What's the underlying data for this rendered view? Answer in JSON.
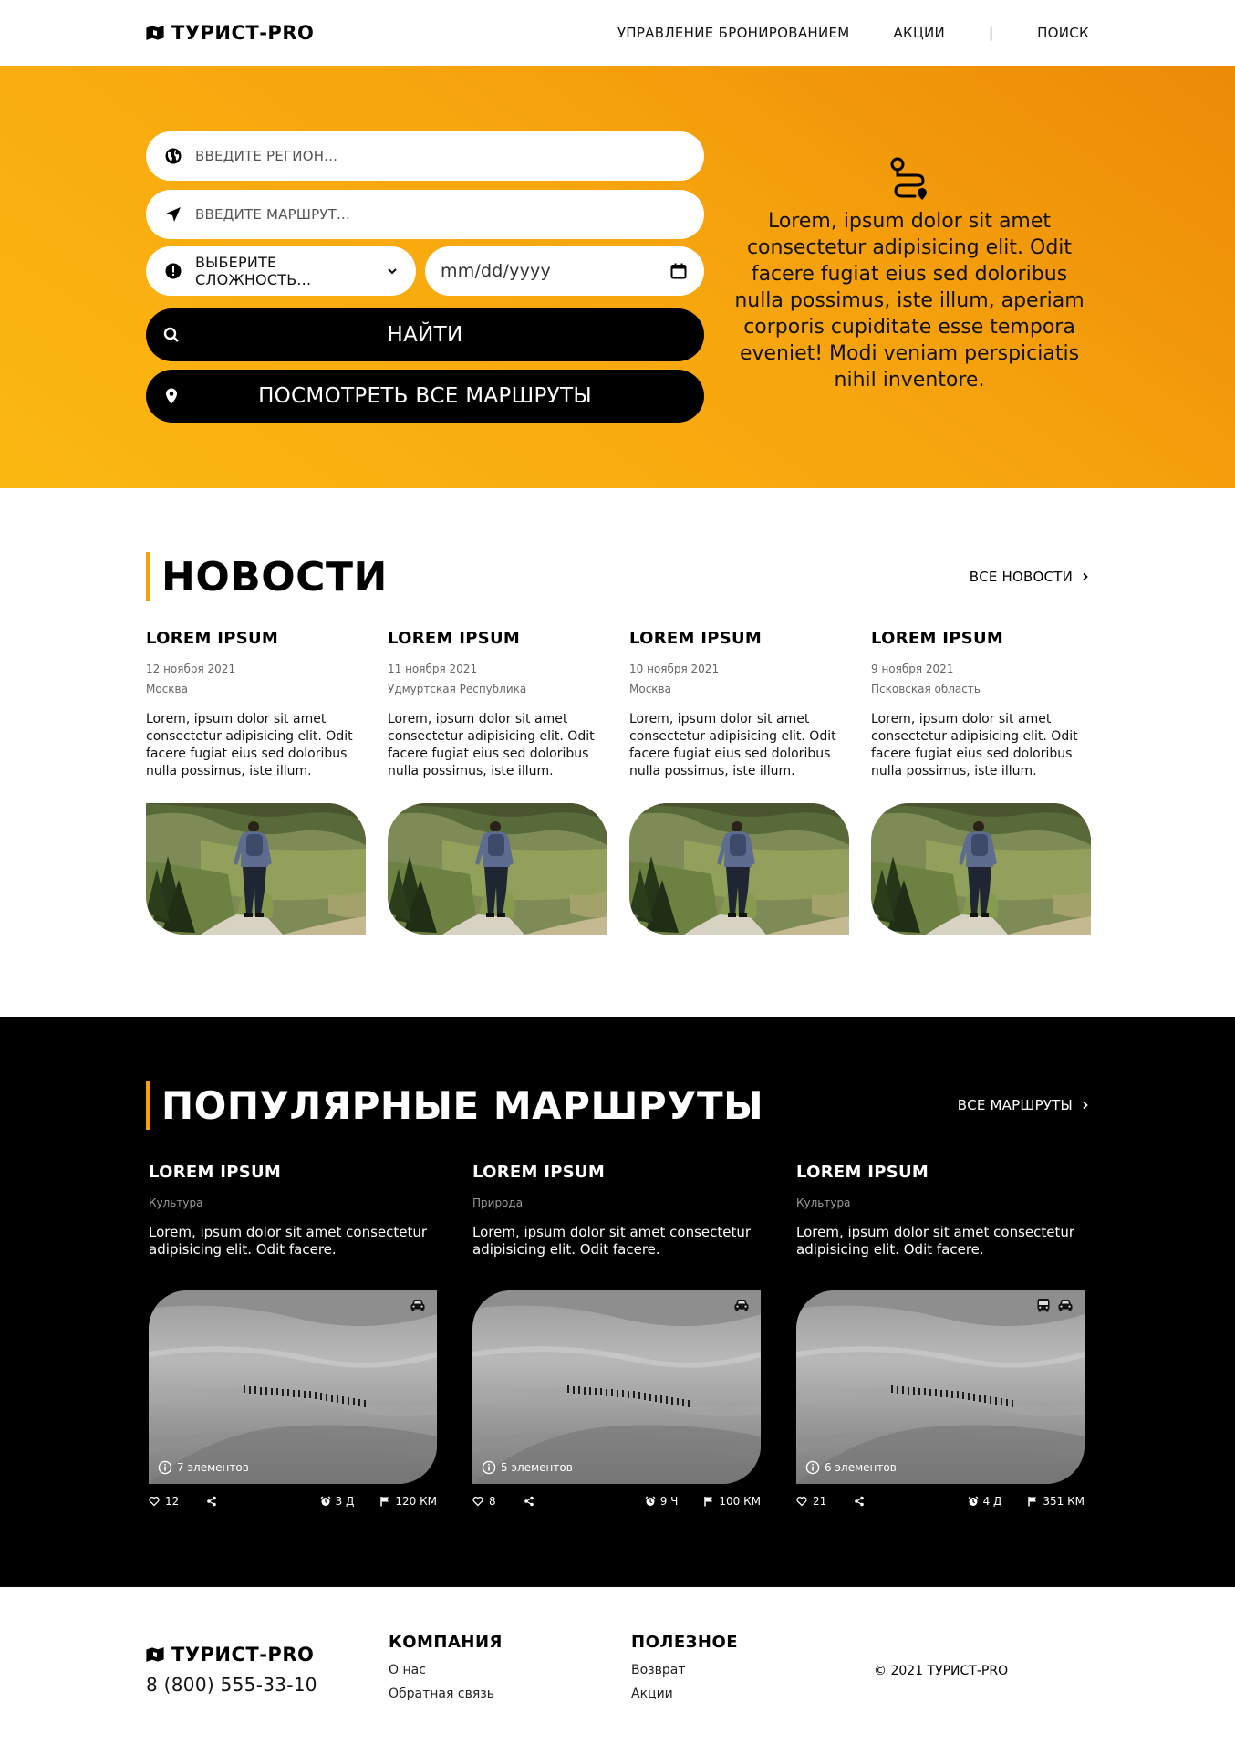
{
  "brand": {
    "name": "ТУРИСТ-PRO",
    "phone": "8 (800) 555-33-10",
    "accent": "#f5a00b"
  },
  "nav": {
    "booking": "УПРАВЛЕНИЕ БРОНИРОВАНИЕМ",
    "promos": "АКЦИИ",
    "separator": "|",
    "search": "ПОИСК"
  },
  "hero": {
    "region_placeholder": "ВВЕДИТЕ РЕГИОН...",
    "route_placeholder": "ВВЕДИТЕ МАРШРУТ...",
    "difficulty_label": "ВЫБЕРИТЕ СЛОЖНОСТЬ...",
    "date_placeholder": "mm/dd/yyyy",
    "find_button": "НАЙТИ",
    "all_routes_button": "ПОСМОТРЕТЬ ВСЕ МАРШРУТЫ",
    "side_text": "Lorem, ipsum dolor sit amet consectetur adipisicing elit. Odit facere fugiat eius sed doloribus nulla possimus, iste illum, aperiam corporis cupiditate esse tempora eveniet! Modi veniam perspiciatis nihil inventore."
  },
  "news": {
    "title": "НОВОСТИ",
    "all_link": "ВСЕ НОВОСТИ",
    "items": [
      {
        "title": "LOREM IPSUM",
        "date": "12 ноября 2021",
        "location": "Москва",
        "text": "Lorem, ipsum dolor sit amet consectetur adipisicing elit. Odit facere fugiat eius sed doloribus nulla possimus, iste illum."
      },
      {
        "title": "LOREM IPSUM",
        "date": "11 ноября 2021",
        "location": "Удмуртская Республика",
        "text": "Lorem, ipsum dolor sit amet consectetur adipisicing elit. Odit facere fugiat eius sed doloribus nulla possimus, iste illum."
      },
      {
        "title": "LOREM IPSUM",
        "date": "10 ноября 2021",
        "location": "Москва",
        "text": "Lorem, ipsum dolor sit amet consectetur adipisicing elit. Odit facere fugiat eius sed doloribus nulla possimus, iste illum."
      },
      {
        "title": "LOREM IPSUM",
        "date": "9 ноября 2021",
        "location": "Псковская область",
        "text": "Lorem, ipsum dolor sit amet consectetur adipisicing elit. Odit facere fugiat eius sed doloribus nulla possimus, iste illum."
      }
    ]
  },
  "routes": {
    "title": "ПОПУЛЯРНЫЕ МАРШРУТЫ",
    "all_link": "ВСЕ МАРШРУТЫ",
    "items": [
      {
        "title": "LOREM IPSUM",
        "category": "Культура",
        "text": "Lorem, ipsum dolor sit amet consectetur adipisicing elit. Odit facere.",
        "elements": "7 элементов",
        "likes": "12",
        "duration": "3 Д",
        "distance": "120 КМ",
        "vehicles": [
          "car-icon"
        ]
      },
      {
        "title": "LOREM IPSUM",
        "category": "Природа",
        "text": "Lorem, ipsum dolor sit amet consectetur adipisicing elit. Odit facere.",
        "elements": "5 элементов",
        "likes": "8",
        "duration": "9 Ч",
        "distance": "100 КМ",
        "vehicles": [
          "car-icon"
        ]
      },
      {
        "title": "LOREM IPSUM",
        "category": "Культура",
        "text": "Lorem, ipsum dolor sit amet consectetur adipisicing elit. Odit facere.",
        "elements": "6 элементов",
        "likes": "21",
        "duration": "4 Д",
        "distance": "351 КМ",
        "vehicles": [
          "bus-icon",
          "car-icon"
        ]
      }
    ]
  },
  "footer": {
    "company_title": "КОМПАНИЯ",
    "company_links": [
      "О нас",
      "Обратная связь"
    ],
    "useful_title": "ПОЛЕЗНОЕ",
    "useful_links": [
      "Возврат",
      "Акции"
    ],
    "copyright": "© 2021 ТУРИСТ-PRO"
  }
}
